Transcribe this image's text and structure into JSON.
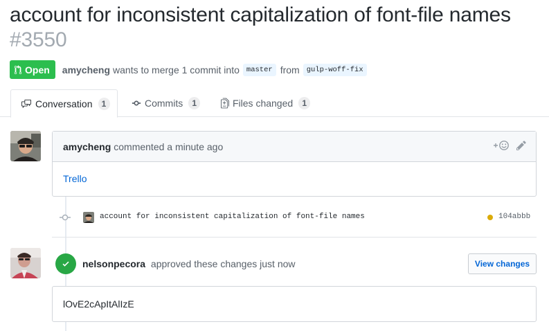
{
  "pr": {
    "title": "account for inconsistent capitalization of font-file names",
    "number": "#3550"
  },
  "meta": {
    "state": "Open",
    "author": "amycheng",
    "text_before_base": "wants to merge 1 commit into",
    "base_branch": "master",
    "text_from": "from",
    "head_branch": "gulp-woff-fix"
  },
  "tabs": [
    {
      "label": "Conversation",
      "count": "1",
      "icon": "conversation-icon",
      "selected": true
    },
    {
      "label": "Commits",
      "count": "1",
      "icon": "commit-icon",
      "selected": false
    },
    {
      "label": "Files changed",
      "count": "1",
      "icon": "file-diff-icon",
      "selected": false
    }
  ],
  "comment": {
    "author": "amycheng",
    "action": "commented a minute ago",
    "body_link": "Trello",
    "actions": [
      "add-reaction-icon",
      "edit-pencil-icon"
    ]
  },
  "commit": {
    "message": "account for inconsistent capitalization of font-file names",
    "sha": "104abbb",
    "status_color": "#dbab09"
  },
  "review": {
    "author": "nelsonpecora",
    "action": "approved these changes just now",
    "button": "View changes",
    "body": "lOvE2cApItAlIzE"
  },
  "colors": {
    "open_green": "#2cbe4e",
    "approved_green": "#28a745",
    "link_blue": "#0366d6"
  }
}
